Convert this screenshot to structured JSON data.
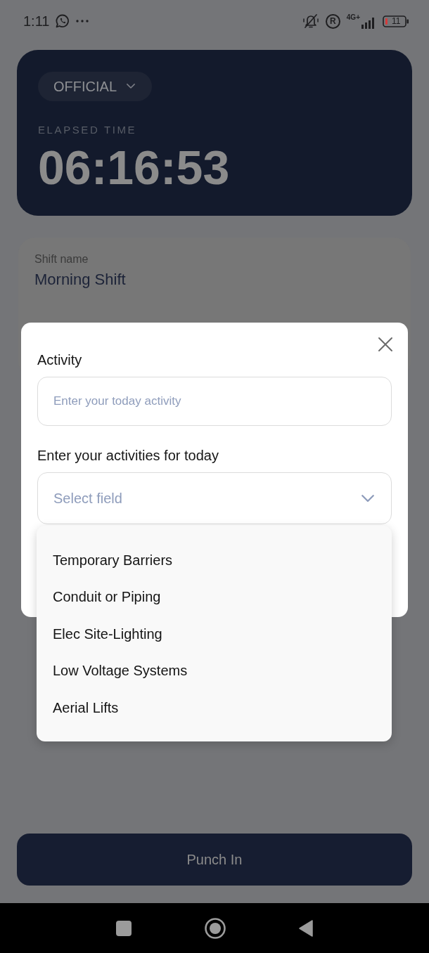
{
  "status_bar": {
    "time": "1:11",
    "roaming": "R",
    "network": "4G+",
    "battery": "11"
  },
  "timer_card": {
    "mode": "OFFICIAL",
    "label": "ELAPSED TIME",
    "elapsed": "06:16:53"
  },
  "shift_card": {
    "label": "Shift name",
    "value": "Morning Shift"
  },
  "modal": {
    "activity": {
      "label": "Activity",
      "placeholder": "Enter your today activity"
    },
    "activities": {
      "label": "Enter your activities for today",
      "placeholder": "Select field",
      "expanded": true,
      "options": [
        {
          "label": "Temporary Barriers",
          "selected": false
        },
        {
          "label": "Conduit or Piping",
          "selected": false
        },
        {
          "label": "Elec Site-Lighting",
          "selected": false
        },
        {
          "label": "Low Voltage Systems",
          "selected": false
        },
        {
          "label": "Aerial Lifts",
          "selected": false
        }
      ]
    }
  },
  "punch_button": {
    "label": "Punch In"
  }
}
